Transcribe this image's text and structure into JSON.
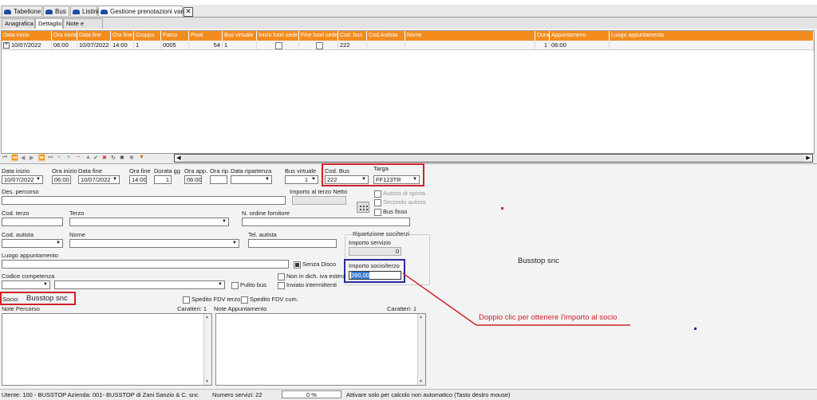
{
  "tabs": [
    {
      "label": "Tabellone"
    },
    {
      "label": "Bus"
    },
    {
      "label": "Listini"
    },
    {
      "label": "Gestione prenotazioni varie"
    }
  ],
  "subtabs": [
    "Anagrafica",
    "Dettaglio",
    "Note e Spese"
  ],
  "grid": {
    "headers": [
      "Data inizio",
      "Ora inizio",
      "Data fine",
      "Ora fine",
      "Gruppo",
      "Parco",
      "Posti",
      "Bus virtuale",
      "Inizio fuori sede",
      "Fine fuori sede",
      "Cod. bus",
      "Cod.Autista",
      "Nome",
      "Dura",
      "Appuntameno",
      "Luogo appuntamento"
    ],
    "row": {
      "data_inizio": "10/07/2022",
      "ora_inizio": "06:00",
      "data_fine": "10/07/2022",
      "ora_fine": "14:00",
      "gruppo": "1",
      "parco": "0005",
      "posti": "54",
      "bus_virtuale": "1",
      "cod_bus": "222",
      "dura": "1",
      "appuntamento": "06:00"
    },
    "header_color": "#f28c1e"
  },
  "form": {
    "data_inizio_label": "Data inizio",
    "data_inizio": "10/07/2022",
    "ora_inizio_label": "Ora inizio",
    "ora_inizio": "06:00",
    "data_fine_label": "Data fine",
    "data_fine": "10/07/2022",
    "ora_fine_label": "Ora fine",
    "ora_fine": "14:00",
    "durata_label": "Durata gg",
    "durata": "1",
    "ora_app_label": "Ora app.",
    "ora_app": "06:00",
    "ora_rip_label": "Ora rip.",
    "data_rip_label": "Data ripartenza",
    "bus_virtuale_label": "Bus virtuale",
    "bus_virtuale": "1",
    "cod_bus_label": "Cod. Bus",
    "cod_bus": "222",
    "targa_label": "Targa",
    "targa": "FF123TR",
    "des_percorso_label": "Des. percorso",
    "importo_terzo_label": "Importo al terzo Netto",
    "autista_spinta": "Autista di spinta",
    "secondo_autista": "Secondo autista",
    "bus_fisso": "Bus fisso",
    "cod_terzo_label": "Cod. terzo",
    "terzo_label": "Terzo",
    "ordine_label": "N. ordine fornitore",
    "cod_autista_label": "Cod. autista",
    "nome_label": "Nome",
    "tel_autista_label": "Tel. autista",
    "ripartizione_label": "Ripartizione soci/terzi",
    "importo_servizio_label": "Importo servizio",
    "importo_servizio": "0",
    "luogo_label": "Luogo appuntamento",
    "senza_disco": "Senza Disco",
    "importo_socio_label": "Importo socio/terzo",
    "importo_socio": "260,00",
    "codice_comp_label": "Codice competenza",
    "pulito_bus": "Pulito bus",
    "non_in_dich": "Non in dich. iva estera",
    "inviato": "Inviato intermittenti",
    "socio_label": "Socio:",
    "socio_value": "Busstop snc",
    "spedito_terzo": "Spedito FDV terzo",
    "spedito_cum": "Spedito FDV cum.",
    "note_percorso_label": "Note Percorso",
    "caratteri_1": "Caratteri: 1",
    "note_app_label": "Note Appuntamento",
    "caratteri_2": "Caratteri: 1"
  },
  "right_info": "Busstop snc",
  "annotation": "Doppio clic per ottenere l'importo al socio",
  "status": {
    "utente": "Utente: 100 - BUSSTOP Azienda: 001- BUSSTOP di  Zani Sanzio & C. snc",
    "servizi": "Numero servizi: 22",
    "progress": "0 %",
    "hint": "Attivare solo per calcolo non automatico (Tasto destro mouse)"
  },
  "colors": {
    "highlight_red": "#d0202a",
    "highlight_blue": "#2c2ca0",
    "accent_orange": "#f28c1e"
  }
}
